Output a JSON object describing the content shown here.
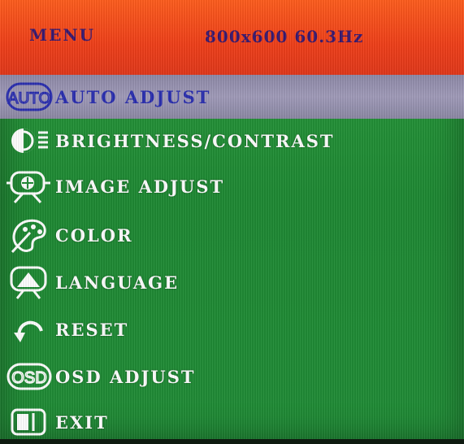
{
  "header": {
    "title": "MENU",
    "resolution": "800x600 60.3Hz"
  },
  "menu": {
    "items": [
      {
        "label": "AUTO ADJUST",
        "icon": "auto-icon",
        "selected": true
      },
      {
        "label": "BRIGHTNESS/CONTRAST",
        "icon": "brightness-contrast-icon",
        "selected": false
      },
      {
        "label": "IMAGE ADJUST",
        "icon": "image-adjust-icon",
        "selected": false
      },
      {
        "label": "COLOR",
        "icon": "color-palette-icon",
        "selected": false
      },
      {
        "label": "LANGUAGE",
        "icon": "language-icon",
        "selected": false
      },
      {
        "label": "RESET",
        "icon": "reset-icon",
        "selected": false
      },
      {
        "label": "OSD ADJUST",
        "icon": "osd-icon",
        "selected": false
      },
      {
        "label": "EXIT",
        "icon": "exit-icon",
        "selected": false
      }
    ],
    "icon_texts": {
      "auto": "AUTO",
      "osd": "OSD"
    }
  },
  "colors": {
    "header_bg": "#f0401a",
    "body_bg": "#1f8a34",
    "selected_bg": "#a19cba",
    "selected_text": "#2b2fb0",
    "item_text": "#ffffff",
    "header_text": "#3a1a70"
  }
}
